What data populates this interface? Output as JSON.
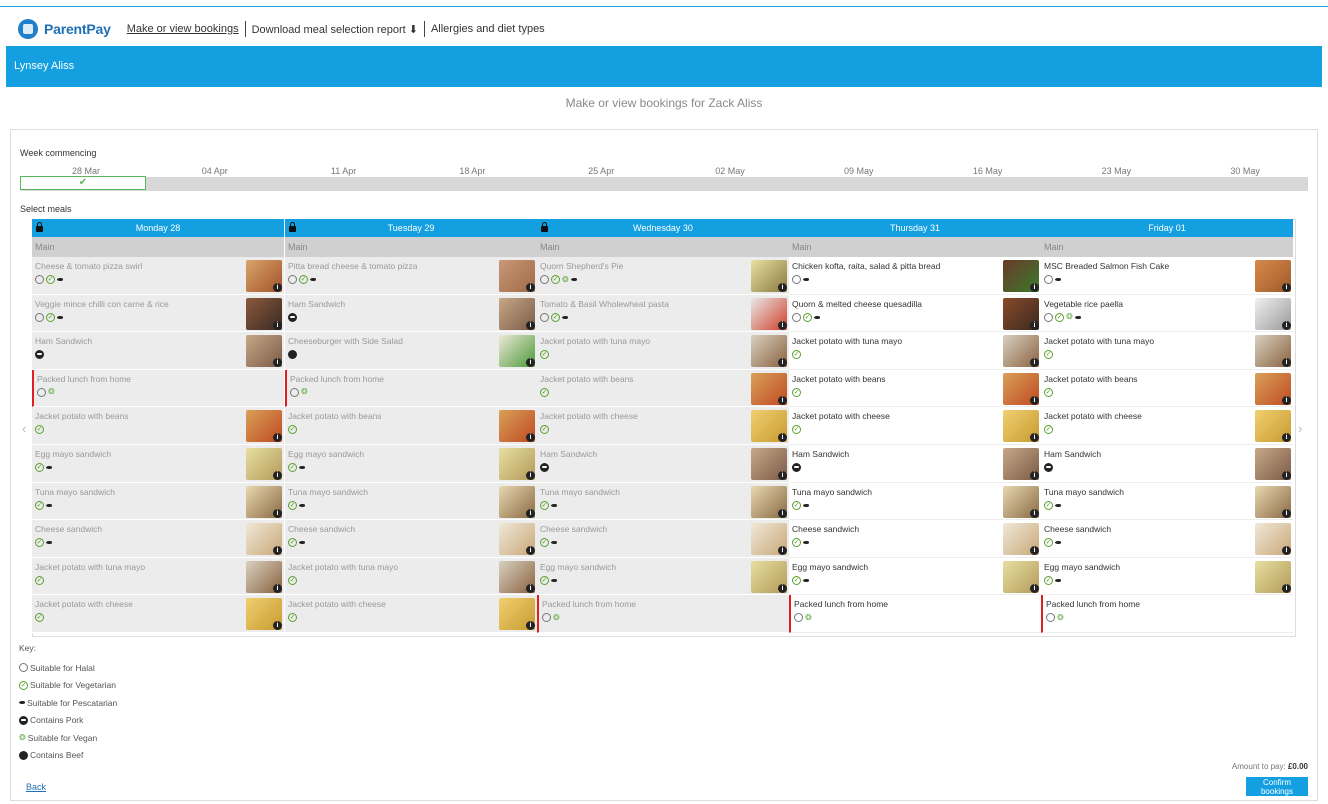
{
  "nav": {
    "brand": "ParentPay",
    "links": [
      "Make or view bookings",
      "Download meal selection report",
      "Allergies and diet types"
    ]
  },
  "user_name": "Lynsey Aliss",
  "page_title": "Make or view bookings for Zack Aliss",
  "week_label": "Week commencing",
  "weeks": [
    "28 Mar",
    "04 Apr",
    "11 Apr",
    "18 Apr",
    "25 Apr",
    "02 May",
    "09 May",
    "16 May",
    "23 May",
    "30 May"
  ],
  "selected_week_index": 0,
  "select_meals_label": "Select meals",
  "days": [
    {
      "label": "Monday 28",
      "locked": true,
      "section": "Main",
      "meals": [
        {
          "name": "Cheese & tomato pizza swirl",
          "icons": [
            "halal",
            "veg",
            "pesc"
          ],
          "thumb": [
            "#d9a46a",
            "#a4532a"
          ]
        },
        {
          "name": "Veggie mince chilli con carne & rice",
          "icons": [
            "halal",
            "veg",
            "pesc"
          ],
          "thumb": [
            "#8a5a3c",
            "#3a2a24"
          ]
        },
        {
          "name": "Ham Sandwich",
          "icons": [
            "pork"
          ],
          "thumb": [
            "#c8a888",
            "#7a5a46"
          ]
        },
        {
          "name": "Packed lunch from home",
          "icons": [
            "halal",
            "vegan"
          ],
          "red": true
        },
        {
          "name": "Jacket potato with beans",
          "icons": [
            "veg"
          ],
          "thumb": [
            "#d8a058",
            "#c04a22"
          ]
        },
        {
          "name": "Egg mayo sandwich",
          "icons": [
            "veg",
            "pesc"
          ],
          "thumb": [
            "#e6dfa0",
            "#b49a5a"
          ]
        },
        {
          "name": "Tuna mayo sandwich",
          "icons": [
            "veg",
            "pesc"
          ],
          "thumb": [
            "#e8d8b0",
            "#8a6a44"
          ]
        },
        {
          "name": "Cheese sandwich",
          "icons": [
            "veg",
            "pesc"
          ],
          "thumb": [
            "#f0e8d8",
            "#c8a878"
          ]
        },
        {
          "name": "Jacket potato with tuna mayo",
          "icons": [
            "veg"
          ],
          "thumb": [
            "#d8d0c0",
            "#8a6240"
          ]
        },
        {
          "name": "Jacket potato with cheese",
          "icons": [
            "veg"
          ],
          "thumb": [
            "#f0d070",
            "#c89a30"
          ]
        }
      ]
    },
    {
      "label": "Tuesday 29",
      "locked": true,
      "section": "Main",
      "meals": [
        {
          "name": "Pitta bread cheese & tomato pizza",
          "icons": [
            "halal",
            "veg",
            "pesc"
          ],
          "thumb": [
            "#c89878",
            "#a06a46"
          ]
        },
        {
          "name": "Ham Sandwich",
          "icons": [
            "pork"
          ],
          "thumb": [
            "#c8a888",
            "#7a5a46"
          ]
        },
        {
          "name": "Cheeseburger with Side Salad",
          "icons": [
            "beef"
          ],
          "thumb": [
            "#f0e8d8",
            "#4a9a3a"
          ]
        },
        {
          "name": "Packed lunch from home",
          "icons": [
            "halal",
            "vegan"
          ],
          "red": true
        },
        {
          "name": "Jacket potato with beans",
          "icons": [
            "veg"
          ],
          "thumb": [
            "#d8a058",
            "#c04a22"
          ]
        },
        {
          "name": "Egg mayo sandwich",
          "icons": [
            "veg",
            "pesc"
          ],
          "thumb": [
            "#e6dfa0",
            "#b49a5a"
          ]
        },
        {
          "name": "Tuna mayo sandwich",
          "icons": [
            "veg",
            "pesc"
          ],
          "thumb": [
            "#e8d8b0",
            "#8a6a44"
          ]
        },
        {
          "name": "Cheese sandwich",
          "icons": [
            "veg",
            "pesc"
          ],
          "thumb": [
            "#f0e8d8",
            "#c8a878"
          ]
        },
        {
          "name": "Jacket potato with tuna mayo",
          "icons": [
            "veg"
          ],
          "thumb": [
            "#d8d0c0",
            "#8a6240"
          ]
        },
        {
          "name": "Jacket potato with cheese",
          "icons": [
            "veg"
          ],
          "thumb": [
            "#f0d070",
            "#c89a30"
          ]
        }
      ]
    },
    {
      "label": "Wednesday 30",
      "locked": true,
      "section": "Main",
      "meals": [
        {
          "name": "Quorn Shepherd's Pie",
          "icons": [
            "halal",
            "veg",
            "vegan",
            "pesc"
          ],
          "thumb": [
            "#e8e0a0",
            "#8a7a40"
          ]
        },
        {
          "name": "Tomato & Basil Wholewheat pasta",
          "icons": [
            "halal",
            "veg",
            "pesc"
          ],
          "thumb": [
            "#e8e8e8",
            "#d0402a"
          ]
        },
        {
          "name": "Jacket potato with tuna mayo",
          "icons": [
            "veg"
          ],
          "thumb": [
            "#d8d0c0",
            "#8a6240"
          ]
        },
        {
          "name": "Jacket potato with beans",
          "icons": [
            "veg"
          ],
          "thumb": [
            "#d8a058",
            "#c04a22"
          ]
        },
        {
          "name": "Jacket potato with cheese",
          "icons": [
            "veg"
          ],
          "thumb": [
            "#f0d070",
            "#c89a30"
          ]
        },
        {
          "name": "Ham Sandwich",
          "icons": [
            "pork"
          ],
          "thumb": [
            "#c8a888",
            "#7a5a46"
          ]
        },
        {
          "name": "Tuna mayo sandwich",
          "icons": [
            "veg",
            "pesc"
          ],
          "thumb": [
            "#e8d8b0",
            "#8a6a44"
          ]
        },
        {
          "name": "Cheese sandwich",
          "icons": [
            "veg",
            "pesc"
          ],
          "thumb": [
            "#f0e8d8",
            "#c8a878"
          ]
        },
        {
          "name": "Egg mayo sandwich",
          "icons": [
            "veg",
            "pesc"
          ],
          "thumb": [
            "#e6dfa0",
            "#b49a5a"
          ]
        },
        {
          "name": "Packed lunch from home",
          "icons": [
            "halal",
            "vegan"
          ],
          "red": true
        }
      ]
    },
    {
      "label": "Thursday 31",
      "locked": false,
      "section": "Main",
      "meals": [
        {
          "name": "Chicken kofta, raita, salad & pitta bread",
          "icons": [
            "halal",
            "pesc"
          ],
          "thumb": [
            "#6a3a2a",
            "#3a7a2a"
          ]
        },
        {
          "name": "Quorn & melted cheese quesadilla",
          "icons": [
            "halal",
            "veg",
            "pesc"
          ],
          "thumb": [
            "#8a4a2a",
            "#3a2a20"
          ]
        },
        {
          "name": "Jacket potato with tuna mayo",
          "icons": [
            "veg"
          ],
          "thumb": [
            "#d8d0c0",
            "#8a6240"
          ]
        },
        {
          "name": "Jacket potato with beans",
          "icons": [
            "veg"
          ],
          "thumb": [
            "#d8a058",
            "#c04a22"
          ]
        },
        {
          "name": "Jacket potato with cheese",
          "icons": [
            "veg"
          ],
          "thumb": [
            "#f0d070",
            "#c89a30"
          ]
        },
        {
          "name": "Ham Sandwich",
          "icons": [
            "pork"
          ],
          "thumb": [
            "#c8a888",
            "#7a5a46"
          ]
        },
        {
          "name": "Tuna mayo sandwich",
          "icons": [
            "veg",
            "pesc"
          ],
          "thumb": [
            "#e8d8b0",
            "#8a6a44"
          ]
        },
        {
          "name": "Cheese sandwich",
          "icons": [
            "veg",
            "pesc"
          ],
          "thumb": [
            "#f0e8d8",
            "#c8a878"
          ]
        },
        {
          "name": "Egg mayo sandwich",
          "icons": [
            "veg",
            "pesc"
          ],
          "thumb": [
            "#e6dfa0",
            "#b49a5a"
          ]
        },
        {
          "name": "Packed lunch from home",
          "icons": [
            "halal",
            "vegan"
          ],
          "red": true
        }
      ]
    },
    {
      "label": "Friday 01",
      "locked": false,
      "section": "Main",
      "meals": [
        {
          "name": "MSC Breaded Salmon Fish Cake",
          "icons": [
            "halal",
            "pesc"
          ],
          "thumb": [
            "#d88a4a",
            "#a05a2a"
          ]
        },
        {
          "name": "Vegetable rice paella",
          "icons": [
            "halal",
            "veg",
            "vegan",
            "pesc"
          ],
          "thumb": [
            "#f0f0f0",
            "#9a9a9a"
          ]
        },
        {
          "name": "Jacket potato with tuna mayo",
          "icons": [
            "veg"
          ],
          "thumb": [
            "#d8d0c0",
            "#8a6240"
          ]
        },
        {
          "name": "Jacket potato with beans",
          "icons": [
            "veg"
          ],
          "thumb": [
            "#d8a058",
            "#c04a22"
          ]
        },
        {
          "name": "Jacket potato with cheese",
          "icons": [
            "veg"
          ],
          "thumb": [
            "#f0d070",
            "#c89a30"
          ]
        },
        {
          "name": "Ham Sandwich",
          "icons": [
            "pork"
          ],
          "thumb": [
            "#c8a888",
            "#7a5a46"
          ]
        },
        {
          "name": "Tuna mayo sandwich",
          "icons": [
            "veg",
            "pesc"
          ],
          "thumb": [
            "#e8d8b0",
            "#8a6a44"
          ]
        },
        {
          "name": "Cheese sandwich",
          "icons": [
            "veg",
            "pesc"
          ],
          "thumb": [
            "#f0e8d8",
            "#c8a878"
          ]
        },
        {
          "name": "Egg mayo sandwich",
          "icons": [
            "veg",
            "pesc"
          ],
          "thumb": [
            "#e6dfa0",
            "#b49a5a"
          ]
        },
        {
          "name": "Packed lunch from home",
          "icons": [
            "halal",
            "vegan"
          ],
          "red": true
        }
      ]
    }
  ],
  "key": {
    "title": "Key:",
    "items": [
      {
        "icon": "halal",
        "label": "Suitable for Halal"
      },
      {
        "icon": "veg",
        "label": "Suitable for Vegetarian"
      },
      {
        "icon": "pesc",
        "label": "Suitable for Pescatarian"
      },
      {
        "icon": "pork",
        "label": "Contains Pork"
      },
      {
        "icon": "vegan",
        "label": "Suitable for Vegan"
      },
      {
        "icon": "beef",
        "label": "Contains Beef"
      }
    ]
  },
  "amount_label": "Amount to pay:",
  "amount_value": "£0.00",
  "confirm_label": "Confirm bookings",
  "back_label": "Back",
  "colors": {
    "primary": "#139fe0",
    "brand": "#1f6fb6",
    "selected_week": "#5cb85c",
    "packed_lunch_marker": "#e02020"
  }
}
